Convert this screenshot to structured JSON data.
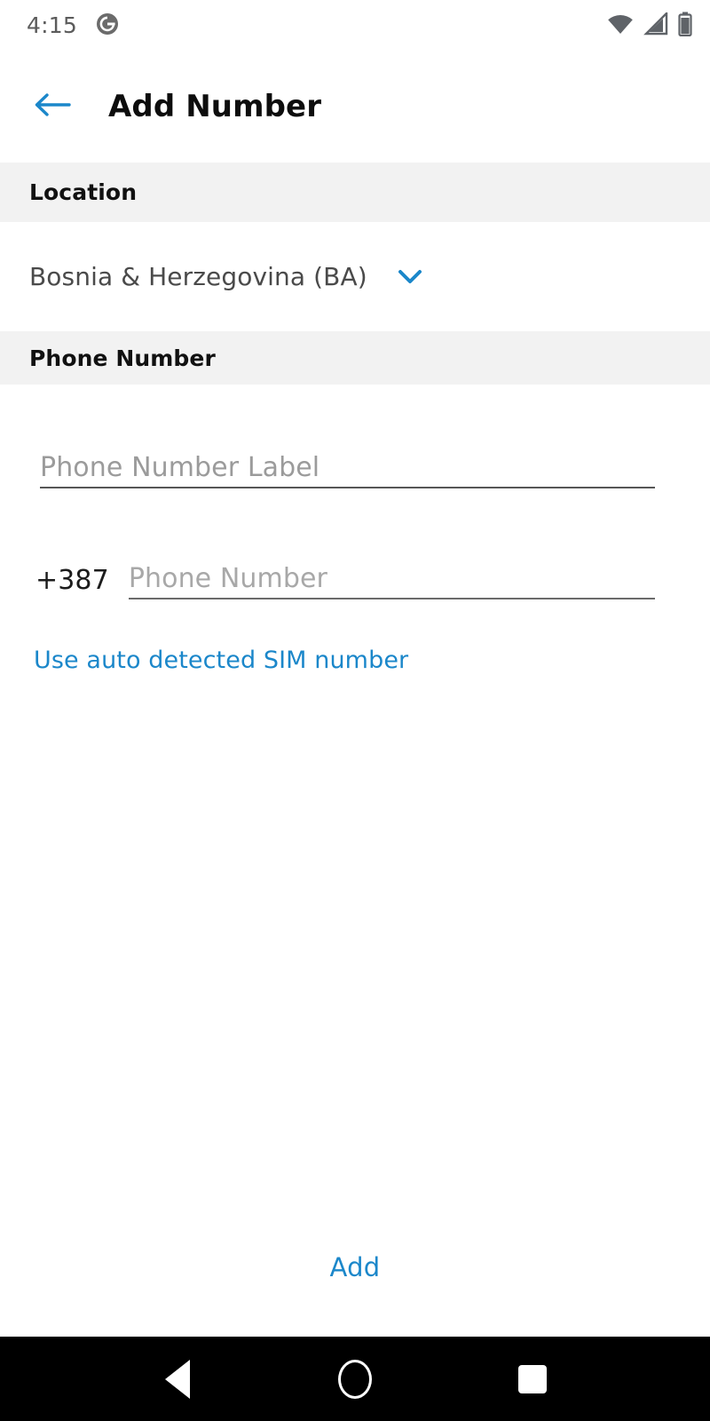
{
  "status_bar": {
    "time": "4:15",
    "notification_icon": "app-circle-g-icon",
    "wifi_icon": "wifi-icon",
    "signal_icon": "cell-signal-icon",
    "battery_icon": "battery-icon",
    "icon_color": "#5f6368"
  },
  "header": {
    "back_icon": "arrow-left-icon",
    "title": "Add Number",
    "accent_color": "#1b87ca"
  },
  "sections": {
    "location": {
      "header": "Location",
      "selected_country": "Bosnia & Herzegovina (BA)",
      "dropdown_icon": "chevron-down-icon"
    },
    "phone_number": {
      "header": "Phone Number",
      "label_field": {
        "value": "",
        "placeholder": "Phone Number Label"
      },
      "country_code": "+387",
      "number_field": {
        "value": "",
        "placeholder": "Phone Number"
      },
      "sim_link": "Use auto detected SIM number"
    }
  },
  "footer": {
    "add_label": "Add"
  },
  "nav_bar": {
    "back_icon": "nav-back-triangle-icon",
    "home_icon": "nav-home-circle-icon",
    "recents_icon": "nav-recents-square-icon"
  },
  "colors": {
    "accent": "#1b87ca",
    "section_bg": "#f2f2f2",
    "page_bg": "#ffffff",
    "nav_bg": "#000000"
  }
}
